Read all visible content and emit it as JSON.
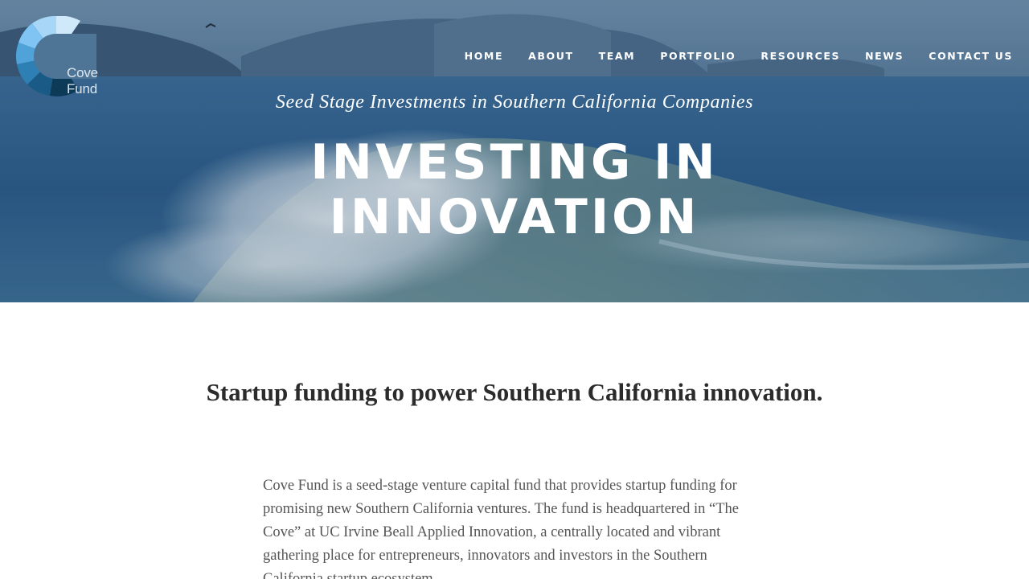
{
  "header": {
    "logo_text": "Cove Fund",
    "nav": [
      {
        "label": "HOME"
      },
      {
        "label": "ABOUT"
      },
      {
        "label": "TEAM"
      },
      {
        "label": "PORTFOLIO"
      },
      {
        "label": "RESOURCES"
      },
      {
        "label": "NEWS"
      },
      {
        "label": "CONTACT US"
      }
    ]
  },
  "hero": {
    "tagline": "Seed Stage Investments in Southern California Companies",
    "headline_line1": "INVESTING IN",
    "headline_line2": "INNOVATION",
    "background": "ocean-wave-photo"
  },
  "main": {
    "subheading": "Startup funding to power Southern California innovation.",
    "intro": "Cove Fund is a seed-stage venture capital fund that provides startup funding for promising new Southern California ventures. The fund is headquartered in “The Cove” at UC Irvine Beall Applied Innovation, a centrally located and vibrant gathering place for entrepreneurs, innovators and investors in the Southern California startup ecosystem."
  },
  "colors": {
    "nav_text": "#ffffff",
    "heading_text": "#2b2b2b",
    "body_text": "#555555",
    "logo_light": "#7fc4f2",
    "logo_dark": "#0d3a57"
  }
}
